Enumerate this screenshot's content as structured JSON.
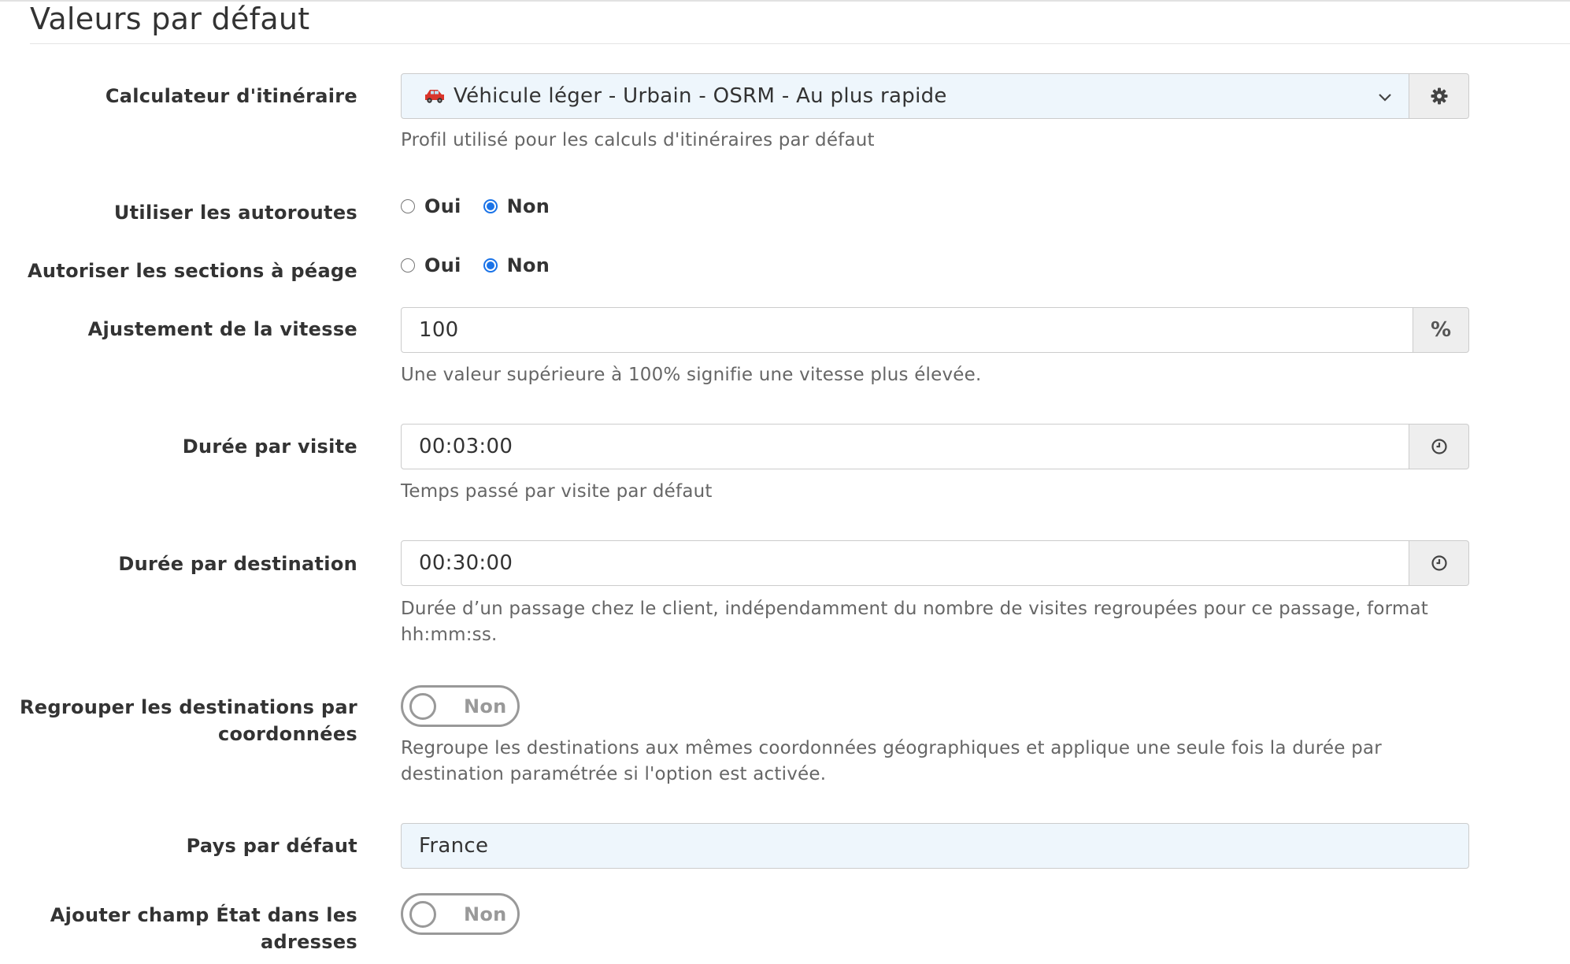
{
  "section": {
    "title": "Valeurs par défaut"
  },
  "router": {
    "label": "Calculateur d'itinéraire",
    "value": "Véhicule léger - Urbain - OSRM - Au plus rapide",
    "icon": "car-icon",
    "settings_icon": "gear-icon",
    "help": "Profil utilisé pour les calculs d'itinéraires par défaut"
  },
  "motorways": {
    "label": "Utiliser les autoroutes",
    "option_yes": "Oui",
    "option_no": "Non",
    "selected": "Non"
  },
  "toll": {
    "label": "Autoriser les sections à péage",
    "option_yes": "Oui",
    "option_no": "Non",
    "selected": "Non"
  },
  "speed": {
    "label": "Ajustement de la vitesse",
    "value": "100",
    "unit": "%",
    "help": "Une valeur supérieure à 100% signifie une vitesse plus élevée."
  },
  "visit_duration": {
    "label": "Durée par visite",
    "value": "00:03:00",
    "icon": "clock-icon",
    "help": "Temps passé par visite par défaut"
  },
  "destination_duration": {
    "label": "Durée par destination",
    "value": "00:30:00",
    "icon": "clock-icon",
    "help": "Durée d’un passage chez le client, indépendamment du nombre de visites regroupées pour ce passage, format hh:mm:ss."
  },
  "group_destinations": {
    "label_line1": "Regrouper les destinations par",
    "label_line2": "coordonnées",
    "toggle_text": "Non",
    "help_line1": "Regroupe les destinations aux mêmes coordonnées géographiques et applique une seule fois la durée par",
    "help_line2": "destination paramétrée si l'option est activée."
  },
  "default_country": {
    "label": "Pays par défaut",
    "value": "France"
  },
  "state_field": {
    "label_line1": "Ajouter champ État dans les",
    "label_line2": "adresses",
    "toggle_text": "Non"
  },
  "colors": {
    "radio_checked": "#1a73e8",
    "select_background": "#eef6fc",
    "addon_background": "#eeeeee",
    "toggle_off": "#999999"
  }
}
